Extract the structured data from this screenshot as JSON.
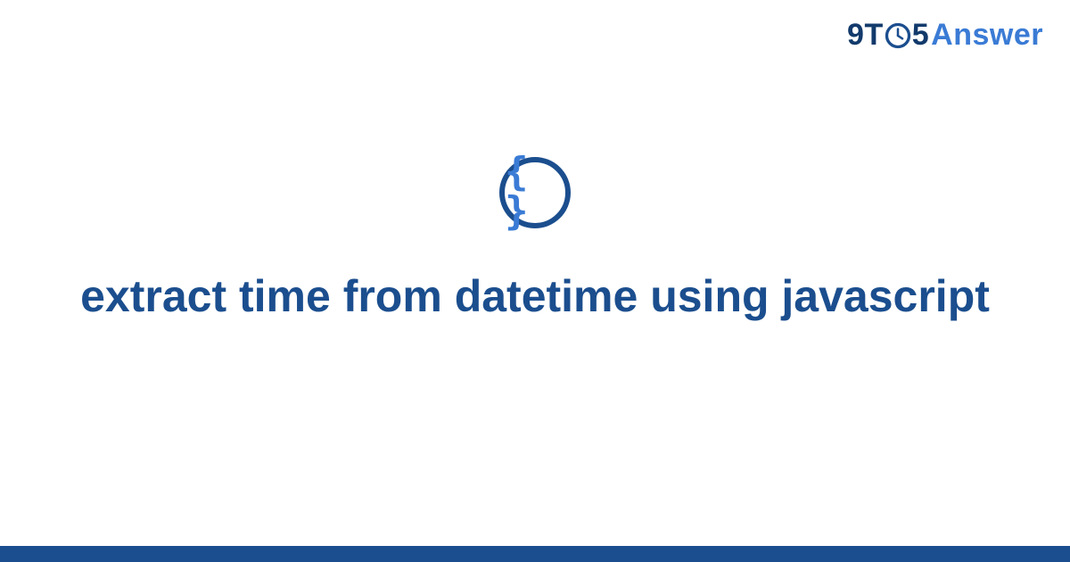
{
  "brand": {
    "nine": "9",
    "t": "T",
    "five": "5",
    "answer": "Answer"
  },
  "center_icon": {
    "glyph": "{ }"
  },
  "title": "extract time from datetime using javascript"
}
